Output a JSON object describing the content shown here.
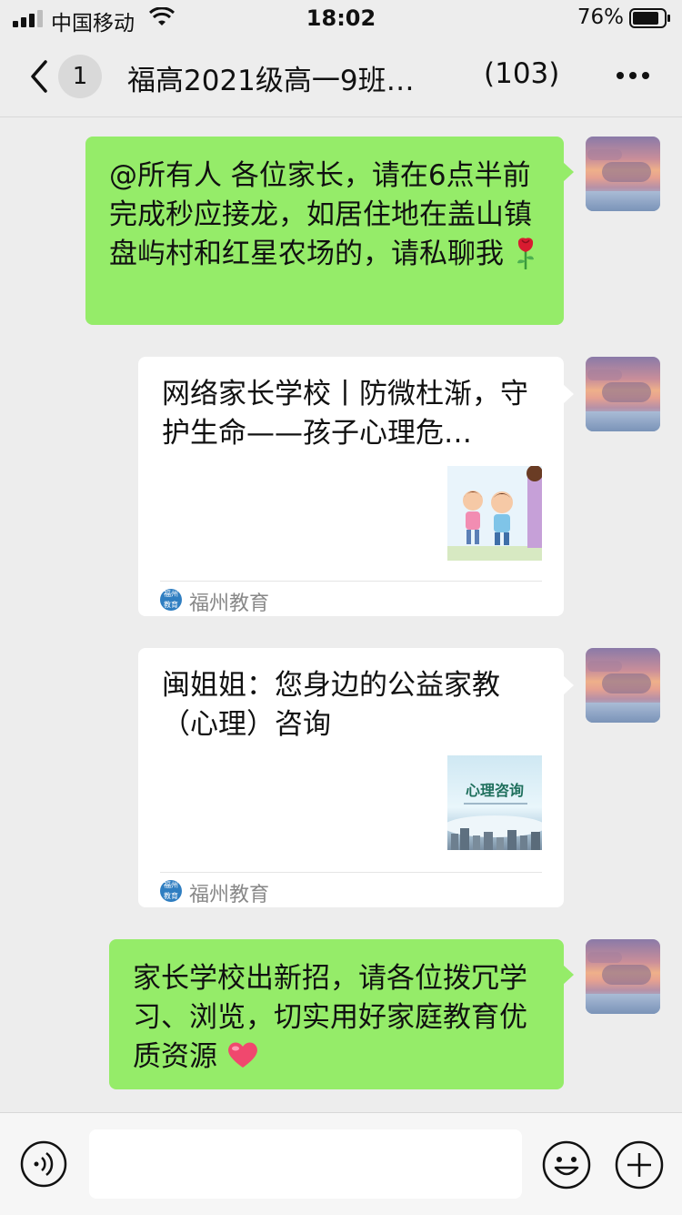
{
  "status_bar": {
    "carrier": "中国移动",
    "time": "18:02",
    "battery_percent": "76%"
  },
  "nav": {
    "unread_count": "1",
    "title": "福高2021级高一9班…",
    "member_count": "(103)"
  },
  "messages": [
    {
      "type": "text",
      "sender": "self",
      "text": "@所有人 各位家长，请在6点半前完成秒应接龙，如居住地在盖山镇盘屿村和红星农场的，请私聊我",
      "emoji": "rose"
    },
    {
      "type": "article",
      "sender": "self",
      "title": "网络家长学校丨防微杜渐，守护生命——孩子心理危…",
      "source": "福州教育",
      "thumb": "children-illustration"
    },
    {
      "type": "article",
      "sender": "self",
      "title": "闽姐姐：您身边的公益家教（心理）咨询",
      "source": "福州教育",
      "thumb": "psych-consult",
      "thumb_text": "心理咨询"
    },
    {
      "type": "text",
      "sender": "self",
      "text": "家长学校出新招，请各位拨冗学习、浏览，切实用好家庭教育优质资源",
      "emoji": "heart"
    }
  ],
  "source_logo_text": "福州教育",
  "input_bar": {
    "placeholder": ""
  },
  "colors": {
    "bubble_green": "#95ec69",
    "background": "#ededed",
    "card": "#ffffff"
  }
}
